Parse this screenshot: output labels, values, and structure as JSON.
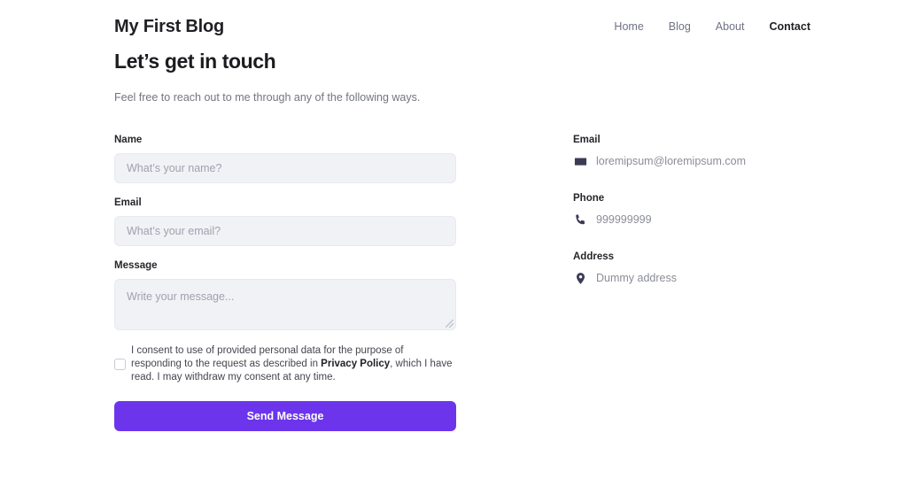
{
  "header": {
    "site_title": "My First Blog",
    "nav": [
      {
        "label": "Home",
        "active": false
      },
      {
        "label": "Blog",
        "active": false
      },
      {
        "label": "About",
        "active": false
      },
      {
        "label": "Contact",
        "active": true
      }
    ]
  },
  "intro": {
    "heading": "Let’s get in touch",
    "subtitle": "Feel free to reach out to me through any of the following ways."
  },
  "form": {
    "name": {
      "label": "Name",
      "placeholder": "What’s your name?",
      "value": ""
    },
    "email": {
      "label": "Email",
      "placeholder": "What’s your email?",
      "value": ""
    },
    "message": {
      "label": "Message",
      "placeholder": "Write your message...",
      "value": ""
    },
    "consent": {
      "checked": false,
      "text_before": "I consent to use of provided personal data for the purpose of responding to the request as described in ",
      "link_label": "Privacy Policy",
      "text_after": ", which I have read. I may withdraw my consent at any time."
    },
    "submit_label": "Send Message"
  },
  "contact": [
    {
      "label": "Email",
      "value": "loremipsum@loremipsum.com",
      "icon": "envelope-icon"
    },
    {
      "label": "Phone",
      "value": "999999999",
      "icon": "phone-icon"
    },
    {
      "label": "Address",
      "value": "Dummy address",
      "icon": "map-pin-icon"
    }
  ],
  "colors": {
    "accent": "#6c35ec",
    "text_dark": "#1f2024",
    "text_muted": "#8b8d98",
    "input_bg": "#f1f2f6",
    "icon_dark": "#3b3b55"
  }
}
